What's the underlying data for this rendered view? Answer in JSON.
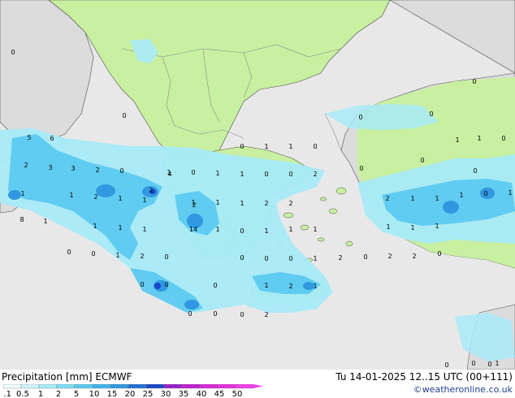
{
  "map": {
    "colors": {
      "sea": "#e8e8e8",
      "land": "#c8f0a0",
      "land_grey": "#dcdcdc",
      "border": "#8a8a8a",
      "coast": "#4a4a4a",
      "precip_light": "#a8eaf8",
      "precip_mid": "#5ccaf0",
      "precip_high": "#3098e0",
      "precip_max": "#1848c8"
    },
    "point_values": [
      "0",
      "0",
      "0",
      "1",
      "1",
      "0",
      "0",
      "0",
      "0",
      "1",
      "1",
      "0",
      "0",
      "0",
      "0",
      "0",
      "5",
      "6",
      "2",
      "3",
      "3",
      "2",
      "0",
      "1",
      "1",
      "2",
      "1",
      "1",
      "1",
      "0",
      "1",
      "1",
      "0",
      "0",
      "2",
      "8",
      "1",
      "1",
      "1",
      "1",
      "2",
      "1",
      "1",
      "1",
      "2",
      "2",
      "2",
      "1",
      "1",
      "1",
      "0",
      "1",
      "4",
      "2",
      "1",
      "0",
      "1",
      "1",
      "1",
      "14",
      "1",
      "1",
      "1",
      "0",
      "0",
      "1",
      "2",
      "0",
      "0",
      "2",
      "2",
      "0",
      "0",
      "0",
      "0",
      "1",
      "2",
      "0",
      "0",
      "0",
      "1",
      "2",
      "1",
      "0",
      "0",
      "0",
      "2",
      "0",
      "0",
      "1",
      "0",
      "0",
      "0"
    ]
  },
  "footer": {
    "title": "Precipitation [mm]  ECMWF",
    "timestamp": "Tu 14-01-2025 12..15 UTC (00+111)",
    "credit": "©weatheronline.co.uk"
  },
  "legend": {
    "labels": [
      "0.1",
      "0.5",
      "1",
      "2",
      "5",
      "10",
      "15",
      "20",
      "25",
      "30",
      "35",
      "40",
      "45",
      "50"
    ],
    "colors": [
      "#f0fcff",
      "#d0f4fc",
      "#a8eaf8",
      "#80dcf4",
      "#5ccaf0",
      "#3cb4ec",
      "#3098e0",
      "#2470d4",
      "#1848c8",
      "#9820c8",
      "#c020d0",
      "#d828d8",
      "#e830e0",
      "#f040e8"
    ]
  }
}
